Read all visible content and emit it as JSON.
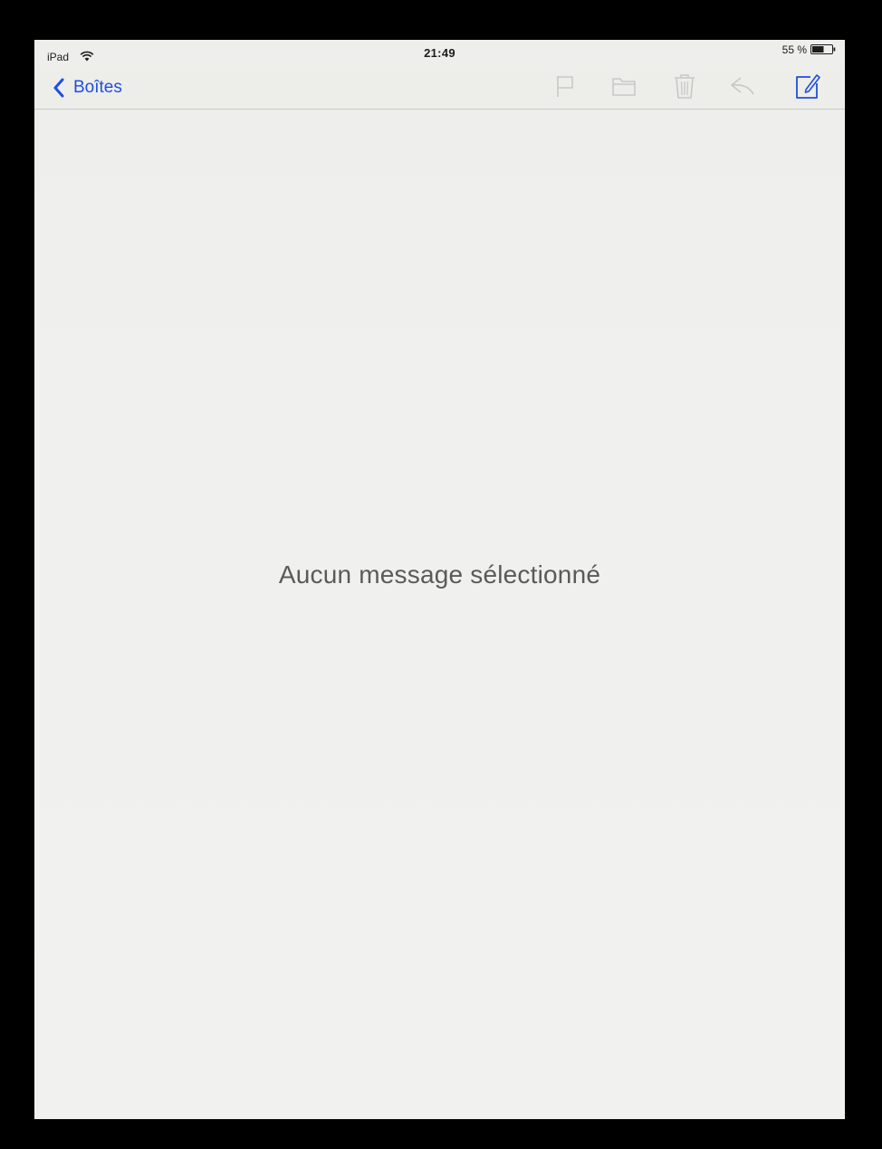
{
  "status_bar": {
    "device": "iPad",
    "time": "21:49",
    "battery": "55 %"
  },
  "nav": {
    "back_label": "Boîtes"
  },
  "toolbar": {
    "icons": [
      "flag-icon",
      "folder-icon",
      "trash-icon",
      "reply-icon",
      "compose-icon"
    ]
  },
  "main": {
    "empty_message": "Aucun message sélectionné"
  },
  "colors": {
    "accent": "#1e4fe0",
    "disabled_icon": "#c8c8c6",
    "background": "#f0f0ee"
  }
}
